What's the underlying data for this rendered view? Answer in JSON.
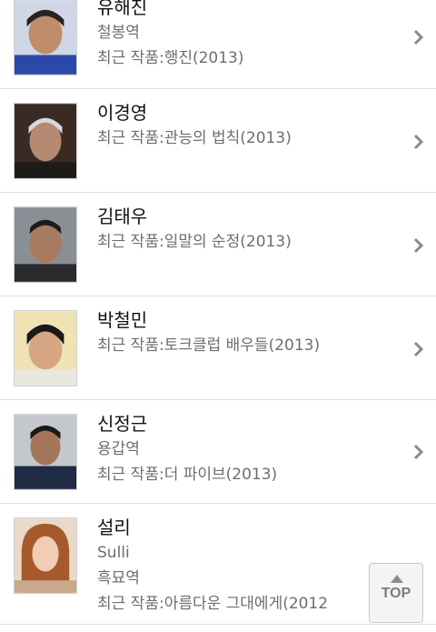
{
  "colors": {
    "name_text": "#111111",
    "sub_text": "#6e6e6e",
    "divider": "#dcdcdc",
    "chevron": "#8a8a8a"
  },
  "cast_list": [
    {
      "name": "유해진",
      "lines": [
        "철봉역",
        "최근 작품:행진(2013)"
      ],
      "photo_icon": "actor-photo"
    },
    {
      "name": "이경영",
      "lines": [
        "최근 작품:관능의 법칙(2013)"
      ],
      "photo_icon": "actor-photo"
    },
    {
      "name": "김태우",
      "lines": [
        "최근 작품:일말의 순정(2013)"
      ],
      "photo_icon": "actor-photo"
    },
    {
      "name": "박철민",
      "lines": [
        "최근 작품:토크클럽 배우들(2013)"
      ],
      "photo_icon": "actor-photo"
    },
    {
      "name": "신정근",
      "lines": [
        "용갑역",
        "최근 작품:더 파이브(2013)"
      ],
      "photo_icon": "actor-photo"
    },
    {
      "name": "설리",
      "lines": [
        "Sulli",
        "흑묘역",
        "최근 작품:아름다운 그대에게(2012"
      ],
      "photo_icon": "actress-photo"
    }
  ],
  "top_button": {
    "label": "TOP",
    "icon": "up-arrow-icon"
  }
}
